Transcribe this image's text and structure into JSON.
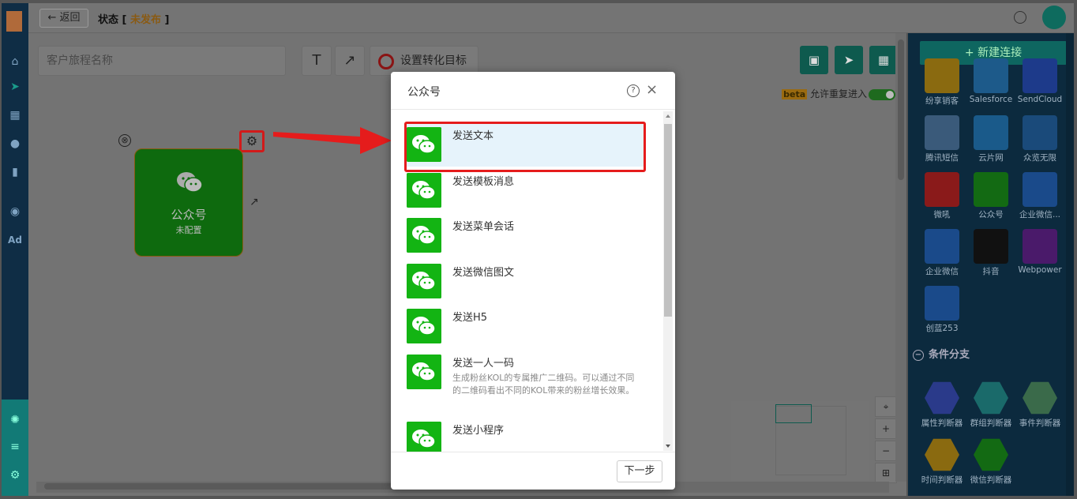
{
  "header": {
    "back_label": "返回",
    "status_prefix": "状态 [ ",
    "status_value": "未发布",
    "status_suffix": " ]"
  },
  "toolbar": {
    "journey_placeholder": "客户旅程名称",
    "text_tool": "T",
    "arrow_tool": "↗",
    "goal_label": "设置转化目标"
  },
  "canvas": {
    "beta_badge": "beta",
    "repeat_label": "允许重复进入",
    "node_title": "公众号",
    "node_subtitle": "未配置",
    "node_close": "⊗"
  },
  "right_panel": {
    "new_connection": "+ 新建连接",
    "connectors": [
      {
        "label": "纷享销客",
        "color": "#8a6a10"
      },
      {
        "label": "Salesforce",
        "color": "#1d5a8a"
      },
      {
        "label": "SendCloud",
        "color": "#1d3a8a"
      },
      {
        "label": "腾讯短信",
        "color": "#3a5a7a"
      },
      {
        "label": "云片网",
        "color": "#1a5a8a"
      },
      {
        "label": "众览无限",
        "color": "#1a4a7a"
      },
      {
        "label": "微吼",
        "color": "#8a1a1a"
      },
      {
        "label": "公众号",
        "color": "#136a13"
      },
      {
        "label": "企业微信...",
        "color": "#1a4a8a"
      },
      {
        "label": "企业微信",
        "color": "#1a4a8a"
      },
      {
        "label": "抖音",
        "color": "#111111"
      },
      {
        "label": "Webpower",
        "color": "#4a1a6a"
      },
      {
        "label": "创蓝253",
        "color": "#1a4a8a"
      }
    ],
    "branch_header": "条件分支",
    "branches": [
      {
        "label": "属性判断器",
        "color": "#2a3a8a"
      },
      {
        "label": "群组判断器",
        "color": "#1a6a6a"
      },
      {
        "label": "事件判断器",
        "color": "#3a6a4a"
      },
      {
        "label": "时间判断器",
        "color": "#8a6a10"
      },
      {
        "label": "微信判断器",
        "color": "#136a13"
      }
    ]
  },
  "modal": {
    "title": "公众号",
    "help_icon": "?",
    "close_icon": "×",
    "items": [
      {
        "title": "发送文本",
        "desc": ""
      },
      {
        "title": "发送模板消息",
        "desc": ""
      },
      {
        "title": "发送菜单会话",
        "desc": ""
      },
      {
        "title": "发送微信图文",
        "desc": ""
      },
      {
        "title": "发送H5",
        "desc": ""
      },
      {
        "title": "发送一人一码",
        "desc": "生成粉丝KOL的专属推广二维码。可以通过不同的二维码看出不同的KOL带来的粉丝增长效果。"
      },
      {
        "title": "发送小程序",
        "desc": ""
      }
    ],
    "next_label": "下一步"
  },
  "colors": {
    "accent": "#13b413",
    "annotation": "#e51c1c",
    "teal": "#0e6660"
  }
}
